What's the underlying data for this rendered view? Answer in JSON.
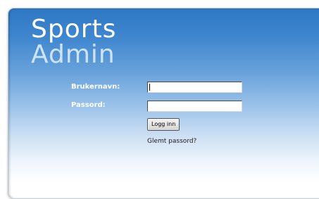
{
  "logo": {
    "line1": "Sports",
    "line2": "Admin"
  },
  "form": {
    "username_label": "Brukernavn:",
    "username_value": "",
    "password_label": "Passord:",
    "password_value": "",
    "login_button": "Logg inn",
    "forgot_link": "Glemt passord?"
  }
}
